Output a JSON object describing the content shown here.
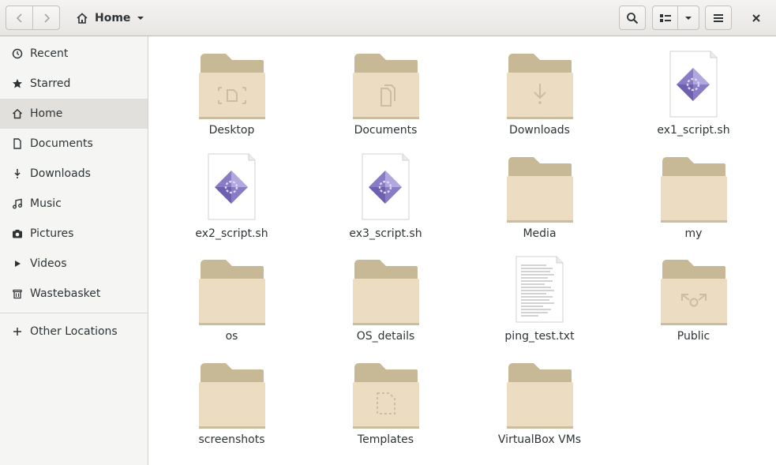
{
  "header": {
    "location": "Home",
    "back_label": "Back",
    "forward_label": "Forward"
  },
  "sidebar": {
    "items": [
      {
        "label": "Recent",
        "icon": "clock-icon"
      },
      {
        "label": "Starred",
        "icon": "star-icon"
      },
      {
        "label": "Home",
        "icon": "home-icon",
        "active": true
      },
      {
        "label": "Documents",
        "icon": "document-icon"
      },
      {
        "label": "Downloads",
        "icon": "download-icon"
      },
      {
        "label": "Music",
        "icon": "music-icon"
      },
      {
        "label": "Pictures",
        "icon": "camera-icon"
      },
      {
        "label": "Videos",
        "icon": "video-icon"
      },
      {
        "label": "Wastebasket",
        "icon": "trash-icon"
      }
    ],
    "other_locations": "Other Locations"
  },
  "files": [
    {
      "name": "Desktop",
      "type": "folder-desktop"
    },
    {
      "name": "Documents",
      "type": "folder-documents"
    },
    {
      "name": "Downloads",
      "type": "folder-downloads"
    },
    {
      "name": "ex1_script.sh",
      "type": "script"
    },
    {
      "name": "ex2_script.sh",
      "type": "script"
    },
    {
      "name": "ex3_script.sh",
      "type": "script"
    },
    {
      "name": "Media",
      "type": "folder"
    },
    {
      "name": "my",
      "type": "folder"
    },
    {
      "name": "os",
      "type": "folder"
    },
    {
      "name": "OS_details",
      "type": "folder"
    },
    {
      "name": "ping_test.txt",
      "type": "text"
    },
    {
      "name": "Public",
      "type": "folder-public"
    },
    {
      "name": "screenshots",
      "type": "folder"
    },
    {
      "name": "Templates",
      "type": "folder-templates"
    },
    {
      "name": "VirtualBox VMs",
      "type": "folder"
    }
  ],
  "colors": {
    "folder_back": "#c7b896",
    "folder_front": "#ecdcc1",
    "active_row": "#e2e0dd",
    "script_purple": "#8a7cc4"
  }
}
